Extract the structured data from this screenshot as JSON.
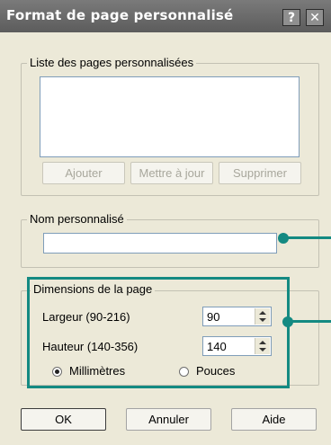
{
  "window": {
    "title": "Format de page personnalisé",
    "help_glyph": "?",
    "close_glyph": "✕"
  },
  "custom_list": {
    "legend": "Liste des pages personnalisées",
    "items": [],
    "add_label": "Ajouter",
    "update_label": "Mettre à jour",
    "delete_label": "Supprimer"
  },
  "custom_name": {
    "legend": "Nom personnalisé",
    "value": ""
  },
  "dimensions": {
    "legend": "Dimensions de la page",
    "width_label": "Largeur (90-216)",
    "width_value": "90",
    "height_label": "Hauteur (140-356)",
    "height_value": "140",
    "unit_mm_label": "Millimètres",
    "unit_in_label": "Pouces",
    "selected_unit": "Millimètres"
  },
  "footer": {
    "ok_label": "OK",
    "cancel_label": "Annuler",
    "help_label": "Aide"
  },
  "colors": {
    "callout": "#148a82",
    "titlebar": "#6a6a6a",
    "dialog_bg": "#ece9d8"
  }
}
